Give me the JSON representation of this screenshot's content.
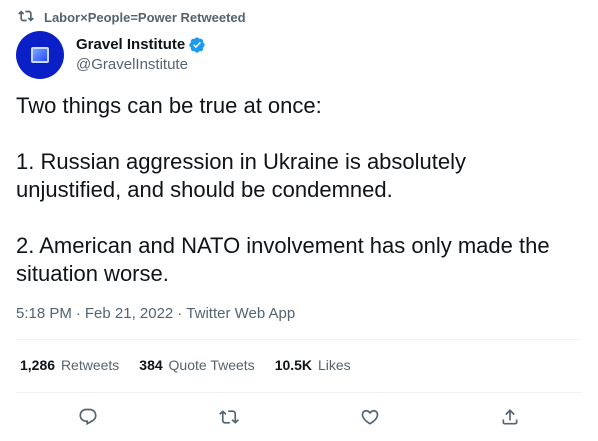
{
  "retweet_context": {
    "text": "Labor×People=Power Retweeted",
    "icon": "retweet-icon"
  },
  "author": {
    "name": "Gravel Institute",
    "handle": "@GravelInstitute",
    "verified": true,
    "avatar_color": "#0b1fc7"
  },
  "tweet": {
    "line1": "Two things can be true at once:",
    "point1_a": "1. Russian aggression in Ukraine is absolutely",
    "point1_b": "unjustified, and should be condemned.",
    "point2_a": "2. American and NATO involvement has only made the",
    "point2_b": "situation worse."
  },
  "meta": {
    "time": "5:18 PM",
    "sep1": "·",
    "date": "Feb 21, 2022",
    "sep2": "·",
    "source": "Twitter Web App"
  },
  "stats": {
    "retweets_count": "1,286",
    "retweets_label": "Retweets",
    "quotes_count": "384",
    "quotes_label": "Quote Tweets",
    "likes_count": "10.5K",
    "likes_label": "Likes"
  },
  "colors": {
    "text": "#0f1419",
    "secondary": "#536471",
    "verified": "#1d9bf0",
    "divider": "#eff3f4"
  },
  "actions": [
    "reply-icon",
    "retweet-icon",
    "like-icon",
    "share-icon"
  ]
}
